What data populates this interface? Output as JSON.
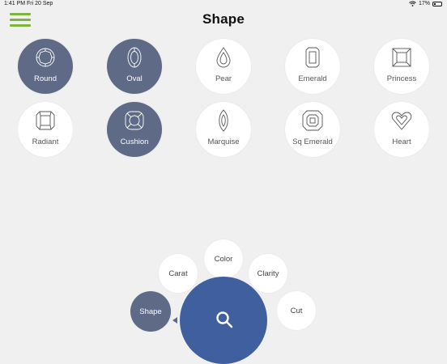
{
  "status": {
    "time": "1:41 PM",
    "date": "Fri 20 Sep",
    "battery": "17%"
  },
  "header": {
    "title": "Shape"
  },
  "shapes": [
    {
      "label": "Round",
      "selected": true,
      "icon": "round-diamond-icon"
    },
    {
      "label": "Oval",
      "selected": true,
      "icon": "oval-diamond-icon"
    },
    {
      "label": "Pear",
      "selected": false,
      "icon": "pear-diamond-icon"
    },
    {
      "label": "Emerald",
      "selected": false,
      "icon": "emerald-diamond-icon"
    },
    {
      "label": "Princess",
      "selected": false,
      "icon": "princess-diamond-icon"
    },
    {
      "label": "Radiant",
      "selected": false,
      "icon": "radiant-diamond-icon"
    },
    {
      "label": "Cushion",
      "selected": true,
      "icon": "cushion-diamond-icon"
    },
    {
      "label": "Marquise",
      "selected": false,
      "icon": "marquise-diamond-icon"
    },
    {
      "label": "Sq Emerald",
      "selected": false,
      "icon": "sq-emerald-diamond-icon"
    },
    {
      "label": "Heart",
      "selected": false,
      "icon": "heart-diamond-icon"
    }
  ],
  "dial": {
    "shape": "Shape",
    "carat": "Carat",
    "color": "Color",
    "clarity": "Clarity",
    "cut": "Cut",
    "search_icon": "search-icon"
  },
  "colors": {
    "selected": "#5e6a86",
    "accent": "#3f5f9e",
    "menu": "#7ab53c",
    "background": "#f0f0f0"
  }
}
